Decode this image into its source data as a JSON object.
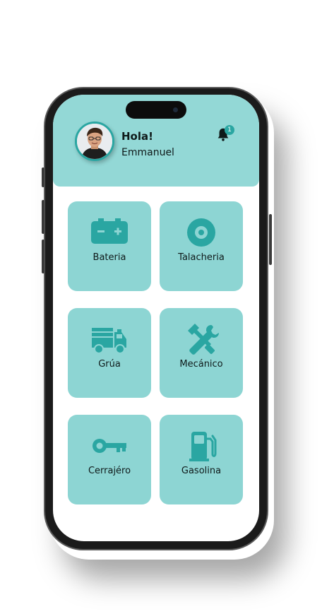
{
  "header": {
    "greeting": "Hola!",
    "user_name": "Emmanuel",
    "notification_count": "1"
  },
  "services": [
    {
      "label": "Bateria",
      "icon": "battery-icon"
    },
    {
      "label": "Talacheria",
      "icon": "tire-icon"
    },
    {
      "label": "Grúa",
      "icon": "tow-truck-icon"
    },
    {
      "label": "Mecánico",
      "icon": "tools-icon"
    },
    {
      "label": "Cerrajéro",
      "icon": "key-icon"
    },
    {
      "label": "Gasolina",
      "icon": "fuel-pump-icon"
    }
  ],
  "colors": {
    "accent": "#2aa6a2",
    "header_bg": "#93d8d6",
    "tile_bg": "#8dd5d3"
  }
}
